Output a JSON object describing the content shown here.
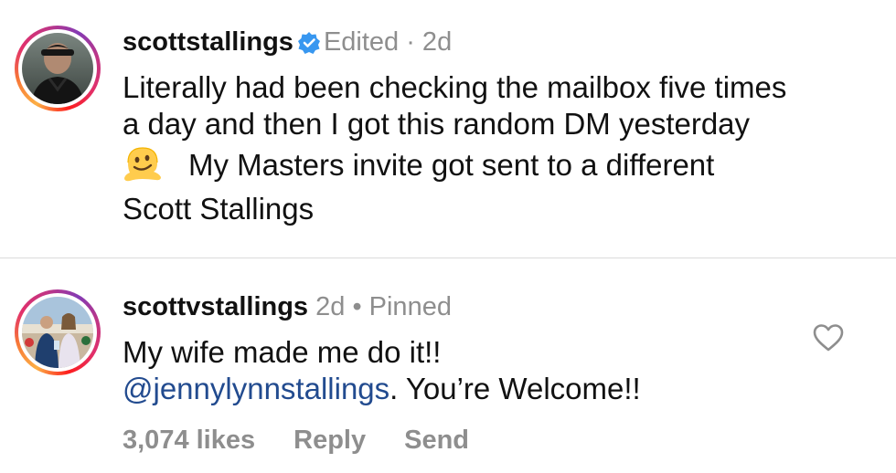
{
  "comments": [
    {
      "username": "scottstallings",
      "verified": true,
      "meta": "Edited · 2d",
      "lines": [
        "Literally had been checking the mailbox five times",
        "a day and then I got this random DM yesterday",
        "My Masters invite got sent to a different",
        "Scott Stallings"
      ],
      "emoji": "melting-face-emoji"
    },
    {
      "username": "scottvstallings",
      "meta": "2d • Pinned",
      "line1": "My wife made me do it!!",
      "mention": "@jennylynnstallings",
      "line2_rest": ". You’re Welcome!!",
      "likes": "3,074 likes",
      "reply_label": "Reply",
      "send_label": "Send",
      "like_icon": "heart-outline-icon"
    }
  ],
  "colors": {
    "text": "#111111",
    "meta": "#8e8e8e",
    "mention": "#224b8f",
    "verified": "#3897f0",
    "divider": "#dbdbdb"
  }
}
